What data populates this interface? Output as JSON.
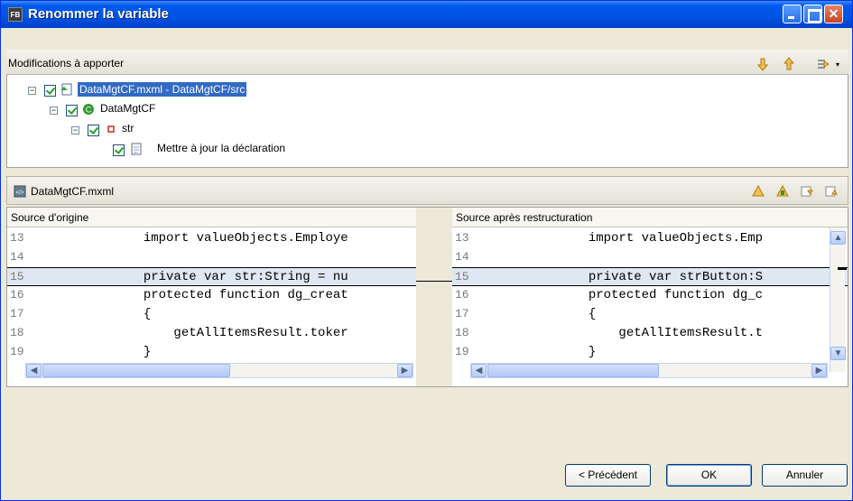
{
  "window": {
    "title": "Renommer la variable",
    "app_icon_label": "FB"
  },
  "changes": {
    "section_title": "Modifications à apporter",
    "tree": [
      {
        "label": "DataMgtCF.mxml - DataMgtCF/src",
        "icon": "file-icon",
        "selected": true
      },
      {
        "label": "DataMgtCF",
        "icon": "class-icon"
      },
      {
        "label": "str",
        "icon": "field-icon"
      },
      {
        "label": "Mettre à jour la déclaration",
        "icon": "edit-doc-icon"
      }
    ]
  },
  "file": {
    "name": "DataMgtCF.mxml"
  },
  "compare": {
    "left_title": "Source d'origine",
    "right_title": "Source après restructuration",
    "left_lines": [
      {
        "n": "13",
        "text": "            import valueObjects.Employe"
      },
      {
        "n": "14",
        "text": ""
      },
      {
        "n": "15",
        "text": "            private var str:String = nu"
      },
      {
        "n": "16",
        "text": "            protected function dg_creat"
      },
      {
        "n": "17",
        "text": "            {"
      },
      {
        "n": "18",
        "text": "                getAllItemsResult.toker"
      },
      {
        "n": "19",
        "text": "            }"
      }
    ],
    "right_lines": [
      {
        "n": "13",
        "text": "            import valueObjects.Emp"
      },
      {
        "n": "14",
        "text": ""
      },
      {
        "n": "15",
        "text": "            private var strButton:S"
      },
      {
        "n": "16",
        "text": "            protected function dg_c"
      },
      {
        "n": "17",
        "text": "            {"
      },
      {
        "n": "18",
        "text": "                getAllItemsResult.t"
      },
      {
        "n": "19",
        "text": "            }"
      }
    ]
  },
  "buttons": {
    "previous": "< Précédent",
    "ok": "OK",
    "cancel": "Annuler"
  }
}
